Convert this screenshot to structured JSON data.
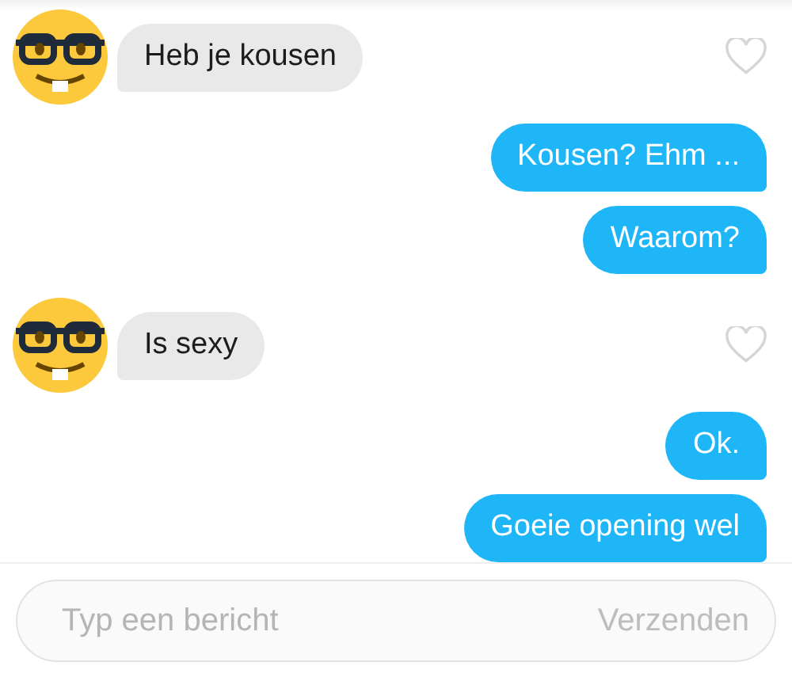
{
  "messages": [
    {
      "kind": "incoming",
      "text": "Heb je kousen",
      "liked": false
    },
    {
      "kind": "outgoing",
      "text": "Kousen? Ehm ..."
    },
    {
      "kind": "outgoing",
      "text": "Waarom?"
    },
    {
      "kind": "incoming",
      "text": "Is sexy",
      "liked": false
    },
    {
      "kind": "outgoing",
      "text": "Ok."
    },
    {
      "kind": "outgoing",
      "text": "Goeie opening wel"
    }
  ],
  "composer": {
    "placeholder": "Typ een bericht",
    "send": "Verzenden"
  }
}
